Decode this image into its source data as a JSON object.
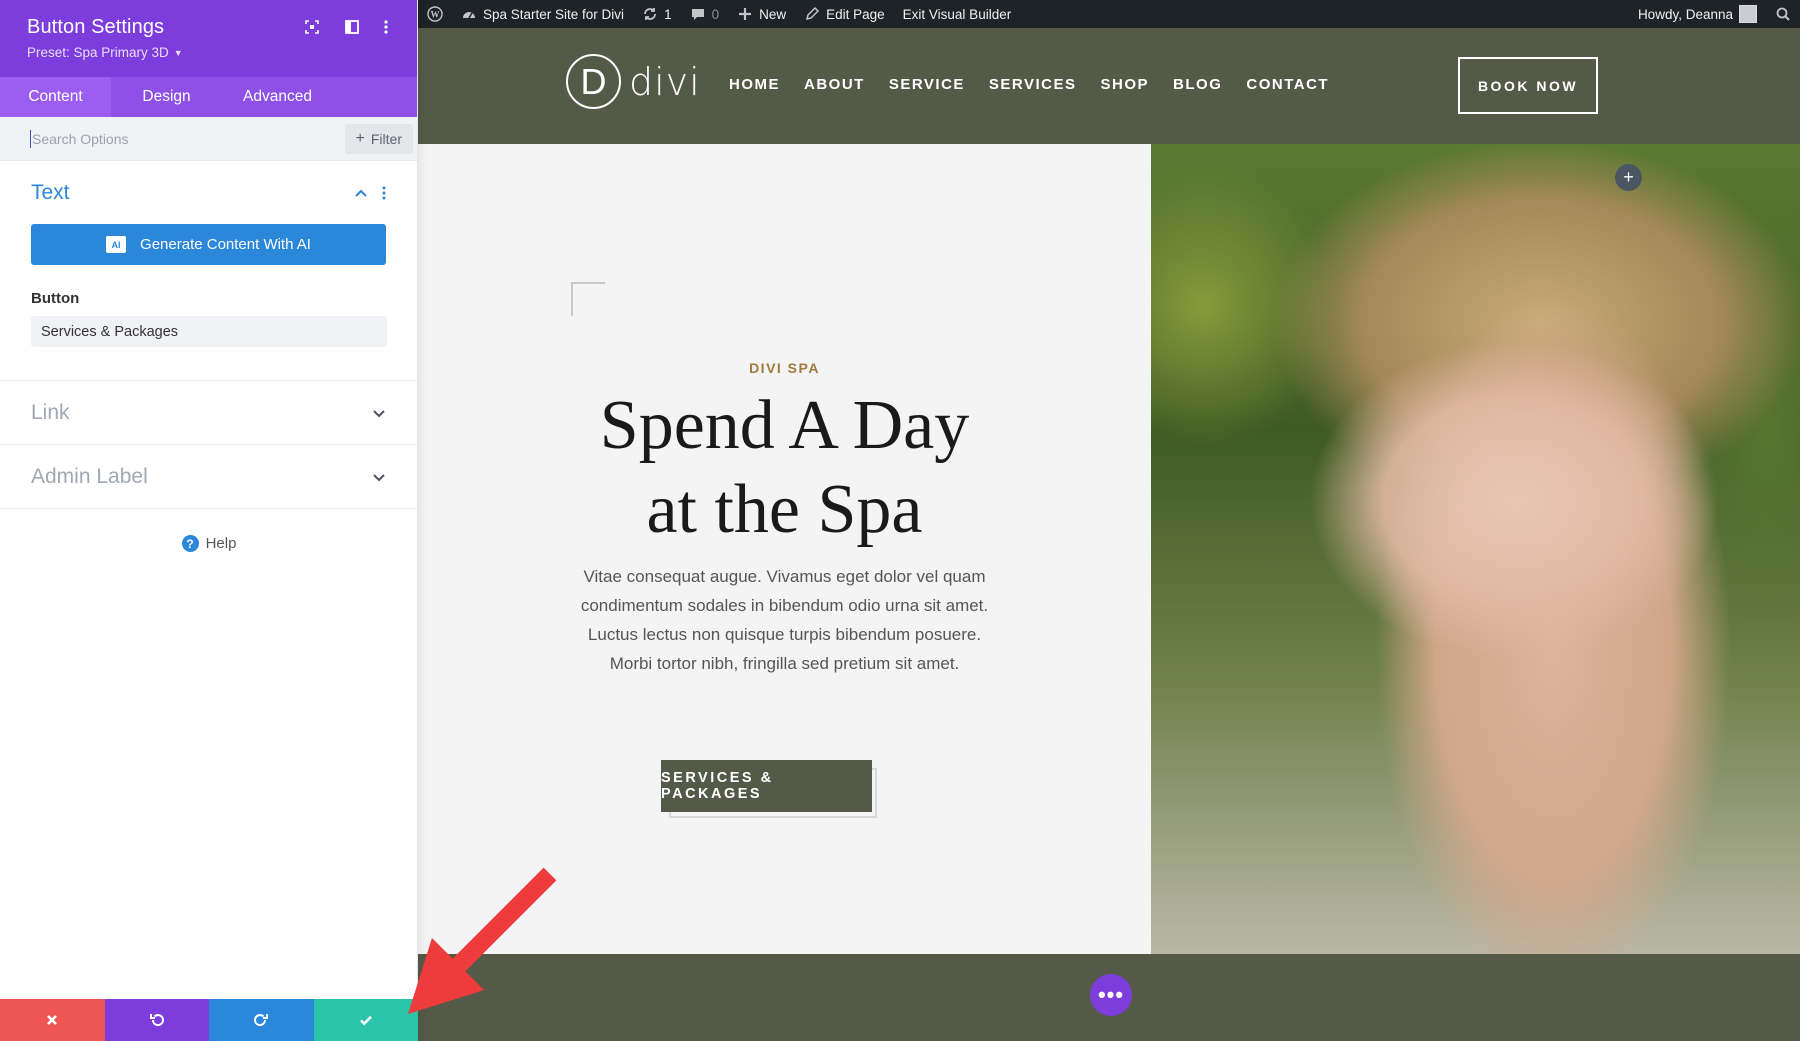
{
  "panel": {
    "title": "Button Settings",
    "preset": "Preset: Spa Primary 3D",
    "tabs": [
      {
        "label": "Content"
      },
      {
        "label": "Design"
      },
      {
        "label": "Advanced"
      }
    ],
    "search_placeholder": "Search Options",
    "filter_label": "Filter",
    "sections": {
      "text": {
        "title": "Text"
      },
      "link": {
        "title": "Link"
      },
      "admin_label": {
        "title": "Admin Label"
      }
    },
    "ai_button": {
      "label": "Generate Content With AI",
      "badge": "AI"
    },
    "button_field": {
      "label": "Button",
      "value": "Services & Packages"
    },
    "help_label": "Help",
    "accent_color": "#7c3ddc",
    "actions": [
      {
        "name": "discard",
        "color": "#ef5555"
      },
      {
        "name": "undo",
        "color": "#7c3ddc"
      },
      {
        "name": "redo",
        "color": "#2b87da"
      },
      {
        "name": "save",
        "color": "#29c4a9"
      }
    ]
  },
  "wp_admin_bar": {
    "site_name": "Spa Starter Site for Divi",
    "updates_count": "1",
    "comments_count": "0",
    "new_label": "New",
    "edit_page_label": "Edit Page",
    "exit_builder_label": "Exit Visual Builder",
    "greeting": "Howdy, Deanna"
  },
  "site": {
    "logo_letter": "D",
    "logo_word": "divi",
    "nav": [
      "HOME",
      "ABOUT",
      "SERVICE",
      "SERVICES",
      "SHOP",
      "BLOG",
      "CONTACT"
    ],
    "book_now": "BOOK NOW",
    "hero": {
      "eyebrow": "DIVI SPA",
      "headline_line1": "Spend A Day",
      "headline_line2": "at the Spa",
      "body": "Vitae consequat augue. Vivamus eget dolor vel quam condimentum sodales in bibendum odio urna sit amet. Luctus lectus non quisque turpis bibendum posuere. Morbi tortor nibh, fringilla sed pretium sit amet.",
      "cta": "SERVICES & PACKAGES"
    },
    "brand_color": "#555a48"
  }
}
